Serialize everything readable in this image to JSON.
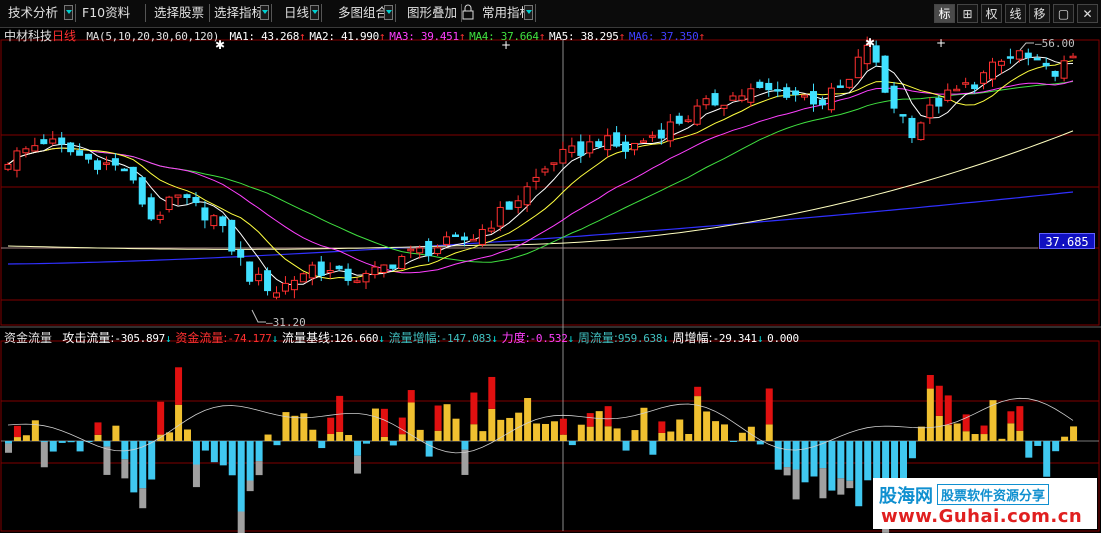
{
  "toolbar": {
    "left_buttons": [
      {
        "label": "技术分析",
        "has_arrow": true
      },
      {
        "label": "F10资料",
        "has_arrow": false
      },
      {
        "label": "选择股票",
        "has_arrow": false
      },
      {
        "label": "选择指标",
        "has_arrow": true
      },
      {
        "label": "日线",
        "has_arrow": true
      },
      {
        "label": "多图组合",
        "has_arrow": true
      },
      {
        "label": "图形叠加",
        "has_arrow": false
      },
      {
        "label": "常用指标",
        "has_arrow": true
      }
    ],
    "lock_icon": "lock-icon",
    "right_buttons": [
      {
        "label": "标",
        "active": true
      },
      {
        "label": "⊞",
        "active": false,
        "icon": "grid-icon"
      },
      {
        "label": "权",
        "active": false
      },
      {
        "label": "线",
        "active": false
      },
      {
        "label": "移",
        "active": false
      },
      {
        "label": "▢",
        "active": false,
        "icon": "window-icon"
      },
      {
        "label": "✕",
        "active": false,
        "icon": "close-icon"
      }
    ]
  },
  "main_info": {
    "stock_name": "中材科技",
    "period": "日线",
    "indicator": "MA(5,10,20,30,60,120)",
    "items": [
      {
        "label": "MA1:",
        "value": "43.268",
        "color": "#ffffff"
      },
      {
        "label": "MA2:",
        "value": "41.990",
        "color": "#ffffff"
      },
      {
        "label": "MA3:",
        "value": "39.451",
        "color": "#ff40ff"
      },
      {
        "label": "MA4:",
        "value": "37.664",
        "color": "#40e040"
      },
      {
        "label": "MA5:",
        "value": "38.295",
        "color": "#ffffff"
      },
      {
        "label": "MA6:",
        "value": "37.350",
        "color": "#4040ff"
      }
    ]
  },
  "sub_info": {
    "title": "资金流量",
    "items": [
      {
        "label": "攻击流量:",
        "value": "-305.897",
        "color": "#ffffff",
        "arrow": "↓"
      },
      {
        "label": "资金流量:",
        "value": "-74.177",
        "color": "#ff3030",
        "arrow": "↓"
      },
      {
        "label": "流量基线:",
        "value": "126.660",
        "color": "#ffffff",
        "arrow": "↓"
      },
      {
        "label": "流量增幅:",
        "value": "-147.083",
        "color": "#40c0c0",
        "arrow": "↓"
      },
      {
        "label": "力度:",
        "value": "-0.532",
        "color": "#ff40ff",
        "arrow": "↓"
      },
      {
        "label": "周流量:",
        "value": "959.638",
        "color": "#40c0c0",
        "arrow": "↓"
      },
      {
        "label": "周增幅:",
        "value": "-29.341",
        "color": "#ffffff",
        "arrow": "↓"
      },
      {
        "label": "",
        "value": "0.000",
        "color": "#ffffff",
        "arrow": ""
      }
    ]
  },
  "annotations": {
    "high_label": "56.00",
    "low_label": "31.20",
    "current_price": "37.685"
  },
  "colors": {
    "up_candle": "#ff3030",
    "down_candle": "#40e0ff",
    "grid": "#800000",
    "ma1": "#ffffff",
    "ma2": "#ffff40",
    "ma3": "#ff40ff",
    "ma4": "#40e040",
    "ma5": "#ffffc0",
    "ma6": "#3030ff",
    "bar_pos": "#f0c030",
    "bar_pos_extra": "#e01010",
    "bar_neg": "#40c8f0",
    "bar_neg_extra": "#a0a0a0"
  },
  "watermark": {
    "brand": "股海网",
    "slogan": "股票软件资源分享",
    "url": "www.Guhai.com.cn"
  }
}
